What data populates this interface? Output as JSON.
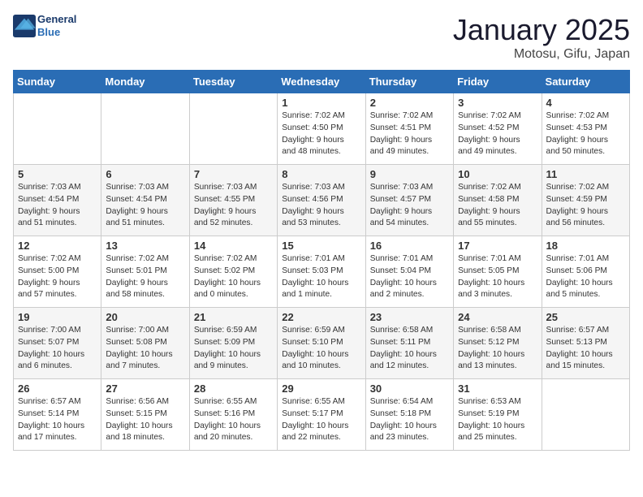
{
  "header": {
    "logo_line1": "General",
    "logo_line2": "Blue",
    "month": "January 2025",
    "location": "Motosu, Gifu, Japan"
  },
  "days_of_week": [
    "Sunday",
    "Monday",
    "Tuesday",
    "Wednesday",
    "Thursday",
    "Friday",
    "Saturday"
  ],
  "weeks": [
    [
      {
        "num": "",
        "info": ""
      },
      {
        "num": "",
        "info": ""
      },
      {
        "num": "",
        "info": ""
      },
      {
        "num": "1",
        "info": "Sunrise: 7:02 AM\nSunset: 4:50 PM\nDaylight: 9 hours\nand 48 minutes."
      },
      {
        "num": "2",
        "info": "Sunrise: 7:02 AM\nSunset: 4:51 PM\nDaylight: 9 hours\nand 49 minutes."
      },
      {
        "num": "3",
        "info": "Sunrise: 7:02 AM\nSunset: 4:52 PM\nDaylight: 9 hours\nand 49 minutes."
      },
      {
        "num": "4",
        "info": "Sunrise: 7:02 AM\nSunset: 4:53 PM\nDaylight: 9 hours\nand 50 minutes."
      }
    ],
    [
      {
        "num": "5",
        "info": "Sunrise: 7:03 AM\nSunset: 4:54 PM\nDaylight: 9 hours\nand 51 minutes."
      },
      {
        "num": "6",
        "info": "Sunrise: 7:03 AM\nSunset: 4:54 PM\nDaylight: 9 hours\nand 51 minutes."
      },
      {
        "num": "7",
        "info": "Sunrise: 7:03 AM\nSunset: 4:55 PM\nDaylight: 9 hours\nand 52 minutes."
      },
      {
        "num": "8",
        "info": "Sunrise: 7:03 AM\nSunset: 4:56 PM\nDaylight: 9 hours\nand 53 minutes."
      },
      {
        "num": "9",
        "info": "Sunrise: 7:03 AM\nSunset: 4:57 PM\nDaylight: 9 hours\nand 54 minutes."
      },
      {
        "num": "10",
        "info": "Sunrise: 7:02 AM\nSunset: 4:58 PM\nDaylight: 9 hours\nand 55 minutes."
      },
      {
        "num": "11",
        "info": "Sunrise: 7:02 AM\nSunset: 4:59 PM\nDaylight: 9 hours\nand 56 minutes."
      }
    ],
    [
      {
        "num": "12",
        "info": "Sunrise: 7:02 AM\nSunset: 5:00 PM\nDaylight: 9 hours\nand 57 minutes."
      },
      {
        "num": "13",
        "info": "Sunrise: 7:02 AM\nSunset: 5:01 PM\nDaylight: 9 hours\nand 58 minutes."
      },
      {
        "num": "14",
        "info": "Sunrise: 7:02 AM\nSunset: 5:02 PM\nDaylight: 10 hours\nand 0 minutes."
      },
      {
        "num": "15",
        "info": "Sunrise: 7:01 AM\nSunset: 5:03 PM\nDaylight: 10 hours\nand 1 minute."
      },
      {
        "num": "16",
        "info": "Sunrise: 7:01 AM\nSunset: 5:04 PM\nDaylight: 10 hours\nand 2 minutes."
      },
      {
        "num": "17",
        "info": "Sunrise: 7:01 AM\nSunset: 5:05 PM\nDaylight: 10 hours\nand 3 minutes."
      },
      {
        "num": "18",
        "info": "Sunrise: 7:01 AM\nSunset: 5:06 PM\nDaylight: 10 hours\nand 5 minutes."
      }
    ],
    [
      {
        "num": "19",
        "info": "Sunrise: 7:00 AM\nSunset: 5:07 PM\nDaylight: 10 hours\nand 6 minutes."
      },
      {
        "num": "20",
        "info": "Sunrise: 7:00 AM\nSunset: 5:08 PM\nDaylight: 10 hours\nand 7 minutes."
      },
      {
        "num": "21",
        "info": "Sunrise: 6:59 AM\nSunset: 5:09 PM\nDaylight: 10 hours\nand 9 minutes."
      },
      {
        "num": "22",
        "info": "Sunrise: 6:59 AM\nSunset: 5:10 PM\nDaylight: 10 hours\nand 10 minutes."
      },
      {
        "num": "23",
        "info": "Sunrise: 6:58 AM\nSunset: 5:11 PM\nDaylight: 10 hours\nand 12 minutes."
      },
      {
        "num": "24",
        "info": "Sunrise: 6:58 AM\nSunset: 5:12 PM\nDaylight: 10 hours\nand 13 minutes."
      },
      {
        "num": "25",
        "info": "Sunrise: 6:57 AM\nSunset: 5:13 PM\nDaylight: 10 hours\nand 15 minutes."
      }
    ],
    [
      {
        "num": "26",
        "info": "Sunrise: 6:57 AM\nSunset: 5:14 PM\nDaylight: 10 hours\nand 17 minutes."
      },
      {
        "num": "27",
        "info": "Sunrise: 6:56 AM\nSunset: 5:15 PM\nDaylight: 10 hours\nand 18 minutes."
      },
      {
        "num": "28",
        "info": "Sunrise: 6:55 AM\nSunset: 5:16 PM\nDaylight: 10 hours\nand 20 minutes."
      },
      {
        "num": "29",
        "info": "Sunrise: 6:55 AM\nSunset: 5:17 PM\nDaylight: 10 hours\nand 22 minutes."
      },
      {
        "num": "30",
        "info": "Sunrise: 6:54 AM\nSunset: 5:18 PM\nDaylight: 10 hours\nand 23 minutes."
      },
      {
        "num": "31",
        "info": "Sunrise: 6:53 AM\nSunset: 5:19 PM\nDaylight: 10 hours\nand 25 minutes."
      },
      {
        "num": "",
        "info": ""
      }
    ]
  ]
}
